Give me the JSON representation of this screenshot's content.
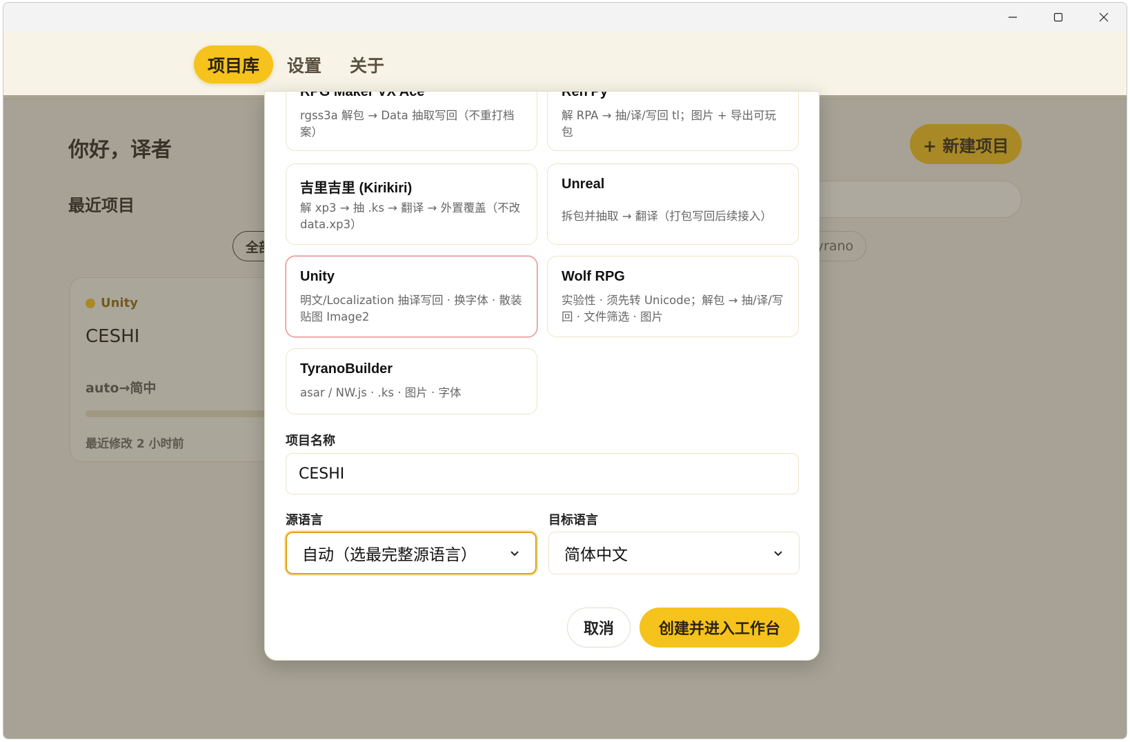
{
  "window": {
    "minimize_label": "─",
    "maximize_label": "☐",
    "close_label": "✕"
  },
  "nav": {
    "tabs": [
      {
        "label": "项目库",
        "active": true
      },
      {
        "label": "设置",
        "active": false
      },
      {
        "label": "关于",
        "active": false
      }
    ]
  },
  "home": {
    "greeting": "你好，译者",
    "new_project_label": "+ 新建项目",
    "recent_title": "最近项目",
    "filter_all": "全部",
    "filter_tyrano": "Tyrano",
    "project_card": {
      "engine": "Unity",
      "name": "CESHI",
      "lang_pair": "auto→简中",
      "modified": "最近修改 2 小时前"
    }
  },
  "modal": {
    "engines": [
      {
        "title": "RPG Maker VX Ace",
        "desc": "rgss3a 解包 → Data 抽取写回（不重打档案）",
        "selected": false
      },
      {
        "title": "Ren'Py",
        "desc": "解 RPA → 抽/译/写回 tl；图片 + 导出可玩包",
        "selected": false
      },
      {
        "title": "吉里吉里 (Kirikiri)",
        "desc": "解 xp3 → 抽 .ks → 翻译 → 外置覆盖（不改 data.xp3）",
        "selected": false
      },
      {
        "title": "Unreal",
        "desc": "拆包并抽取 → 翻译（打包写回后续接入）",
        "selected": false
      },
      {
        "title": "Unity",
        "desc": "明文/Localization 抽译写回 · 换字体 · 散装贴图 Image2",
        "selected": true
      },
      {
        "title": "Wolf RPG",
        "desc": "实验性 · 须先转 Unicode；解包 → 抽/译/写回 · 文件筛选 · 图片",
        "selected": false
      },
      {
        "title": "TyranoBuilder",
        "desc": "asar / NW.js · .ks · 图片 · 字体",
        "selected": false
      }
    ],
    "project_name_label": "项目名称",
    "project_name_value": "CESHI",
    "source_lang_label": "源语言",
    "source_lang_value": "自动（选最完整源语言）",
    "target_lang_label": "目标语言",
    "target_lang_value": "简体中文",
    "cancel_label": "取消",
    "create_label": "创建并进入工作台"
  },
  "colors": {
    "accent": "#f6c21c",
    "header_bg": "#f7f3e6",
    "selected_border": "#e58b8b",
    "focus_border": "#e0a21a"
  }
}
